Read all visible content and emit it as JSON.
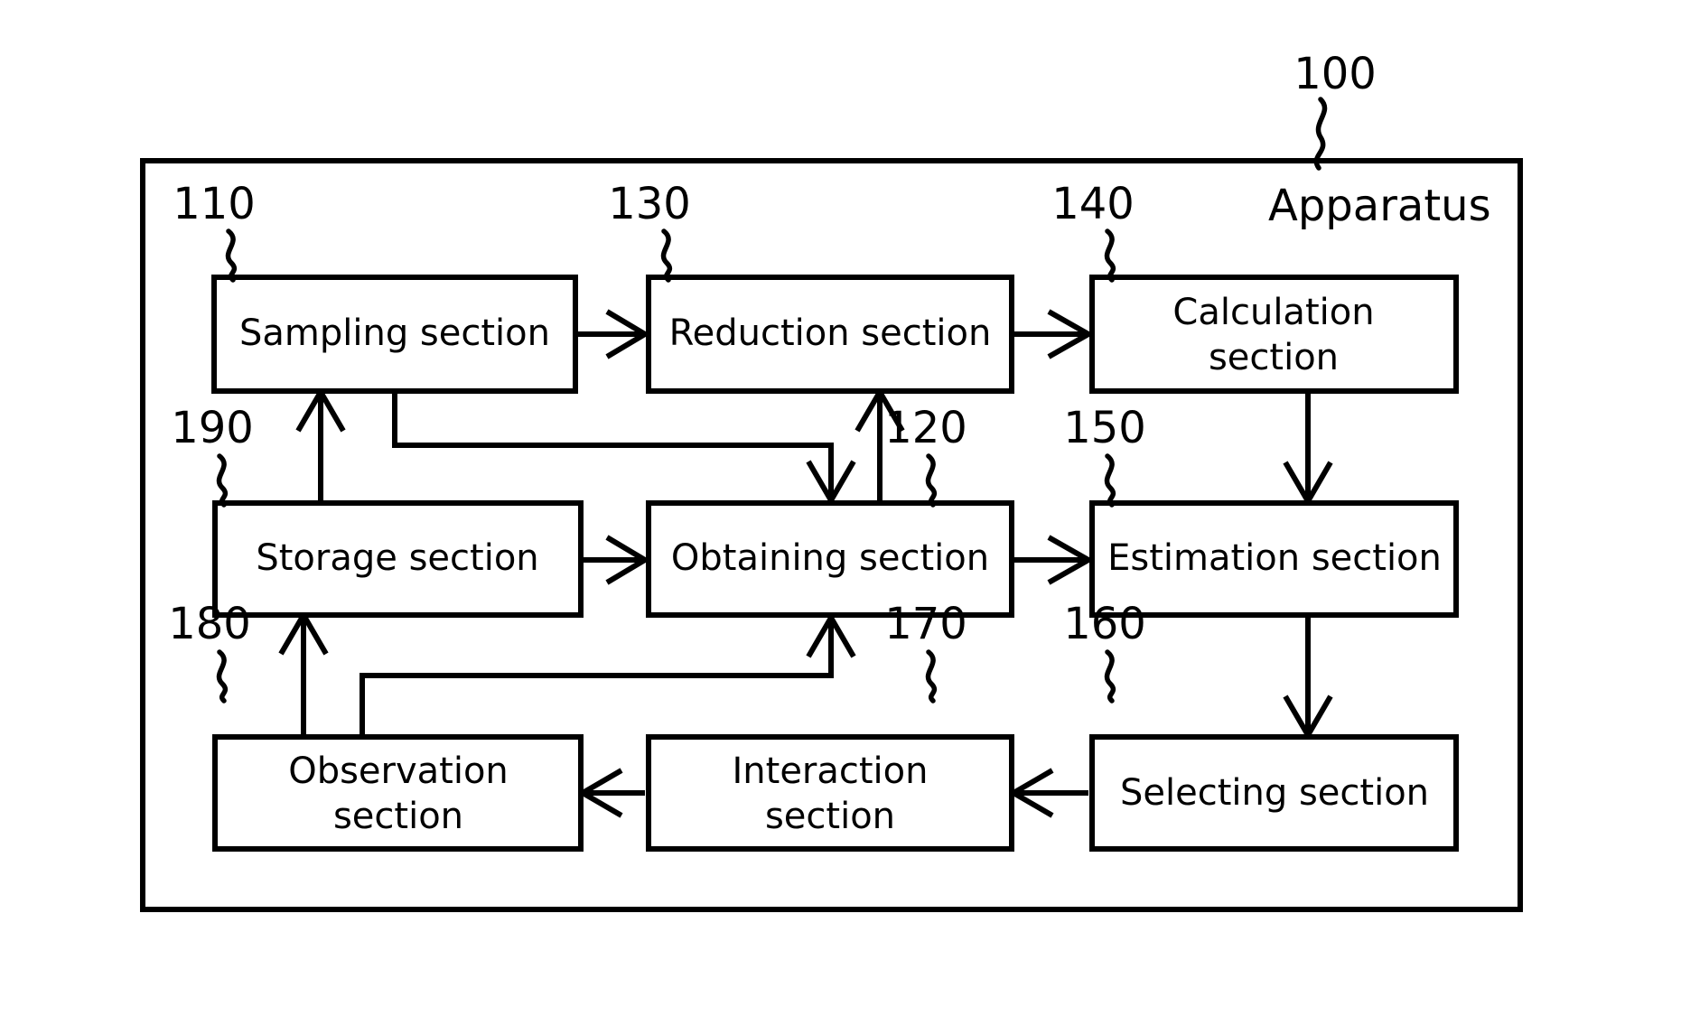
{
  "figure": {
    "title": "Apparatus",
    "apparatus_label": "Apparatus",
    "apparatus_ref": "100",
    "background_color": "#ffffff",
    "line_color": "#000000"
  },
  "blocks": [
    {
      "id": "sampling",
      "ref": "110",
      "label": "Sampling section",
      "line1": "Sampling section",
      "line2": ""
    },
    {
      "id": "reduction",
      "ref": "130",
      "label": "Reduction section",
      "line1": "Reduction section",
      "line2": ""
    },
    {
      "id": "calculation",
      "ref": "140",
      "label": "Calculation section",
      "line1": "Calculation",
      "line2": "section"
    },
    {
      "id": "storage",
      "ref": "190",
      "label": "Storage section",
      "line1": "Storage section",
      "line2": ""
    },
    {
      "id": "obtaining",
      "ref": "120",
      "label": "Obtaining section",
      "line1": "Obtaining section",
      "line2": ""
    },
    {
      "id": "estimation",
      "ref": "150",
      "label": "Estimation section",
      "line1": "Estimation section",
      "line2": ""
    },
    {
      "id": "observation",
      "ref": "180",
      "label": "Observation section",
      "line1": "Observation",
      "line2": "section"
    },
    {
      "id": "interaction",
      "ref": "170",
      "label": "Interaction section",
      "line1": "Interaction",
      "line2": "section"
    },
    {
      "id": "selecting",
      "ref": "160",
      "label": "Selecting section",
      "line1": "Selecting section",
      "line2": ""
    }
  ],
  "connections": [
    {
      "from": "sampling",
      "to": "reduction",
      "name": "sampling-to-reduction"
    },
    {
      "from": "reduction",
      "to": "calculation",
      "name": "reduction-to-calculation"
    },
    {
      "from": "calculation",
      "to": "estimation",
      "name": "calculation-to-estimation"
    },
    {
      "from": "storage",
      "to": "obtaining",
      "name": "storage-to-obtaining"
    },
    {
      "from": "obtaining",
      "to": "estimation",
      "name": "obtaining-to-estimation"
    },
    {
      "from": "estimation",
      "to": "selecting",
      "name": "estimation-to-selecting"
    },
    {
      "from": "selecting",
      "to": "interaction",
      "name": "selecting-to-interaction"
    },
    {
      "from": "interaction",
      "to": "observation",
      "name": "interaction-to-observation"
    },
    {
      "from": "observation",
      "to": "storage",
      "name": "observation-to-storage"
    },
    {
      "from": "observation",
      "to": "obtaining",
      "name": "observation-to-obtaining"
    },
    {
      "from": "storage",
      "to": "sampling",
      "name": "storage-to-sampling"
    },
    {
      "from": "sampling",
      "to": "obtaining",
      "name": "sampling-to-obtaining"
    },
    {
      "from": "obtaining",
      "to": "reduction",
      "name": "obtaining-to-reduction"
    }
  ]
}
